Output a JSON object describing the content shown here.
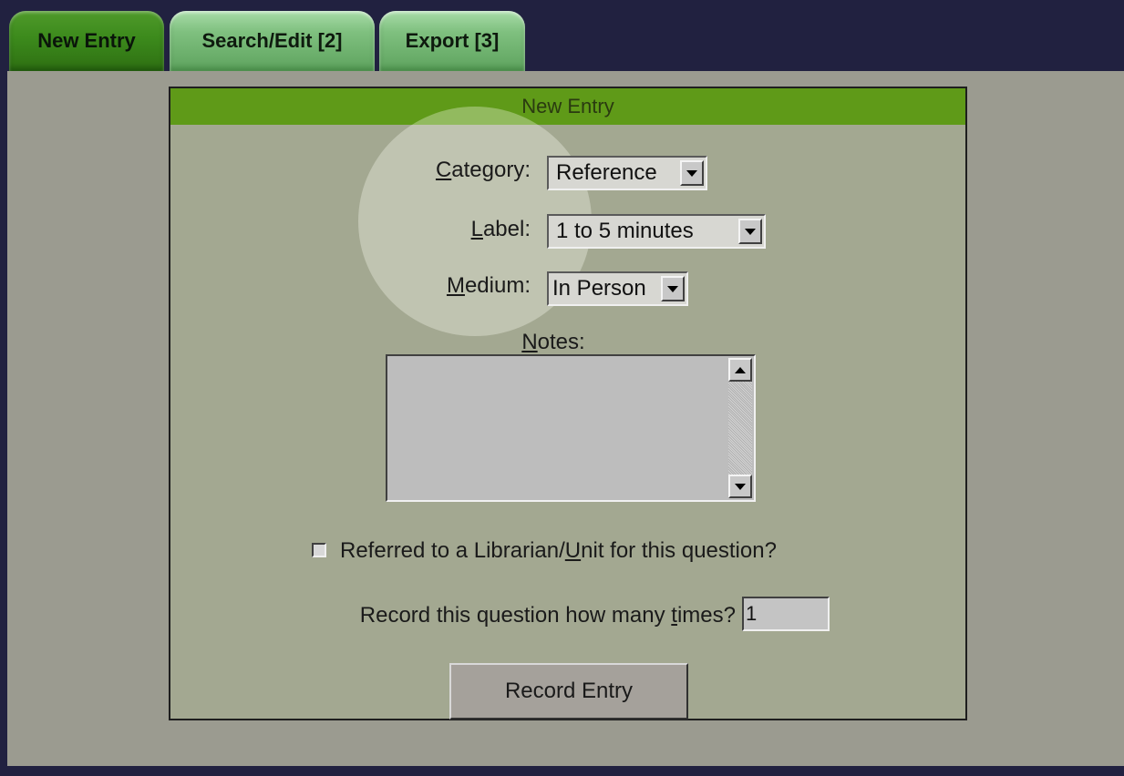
{
  "tabs": [
    {
      "label": "New Entry",
      "active": true
    },
    {
      "label": "Search/Edit [2]",
      "active": false
    },
    {
      "label": "Export [3]",
      "active": false
    }
  ],
  "form": {
    "header": "New Entry",
    "category": {
      "label_pre": "",
      "label_u": "C",
      "label_post": "ategory:",
      "value": "Reference"
    },
    "label_field": {
      "label_pre": "",
      "label_u": "L",
      "label_post": "abel:",
      "value": "1 to 5 minutes"
    },
    "medium": {
      "label_pre": "",
      "label_u": "M",
      "label_post": "edium:",
      "value": "In Person"
    },
    "notes": {
      "label_pre": "",
      "label_u": "N",
      "label_post": "otes:",
      "value": ""
    },
    "referred": {
      "label_pre": "Referred to a Librarian/",
      "label_u": "U",
      "label_post": "nit for this question?",
      "checked": false
    },
    "times": {
      "label_pre": "Record this question how many ",
      "label_u": "t",
      "label_post": "imes?",
      "value": "1"
    },
    "submit_label": "Record Entry"
  },
  "colors": {
    "active_tab": "#3c8a1c",
    "inactive_tab": "#7fc07f",
    "header_bar": "#5f9a18",
    "form_bg": "#a3a891",
    "outer_bg": "#212140"
  }
}
